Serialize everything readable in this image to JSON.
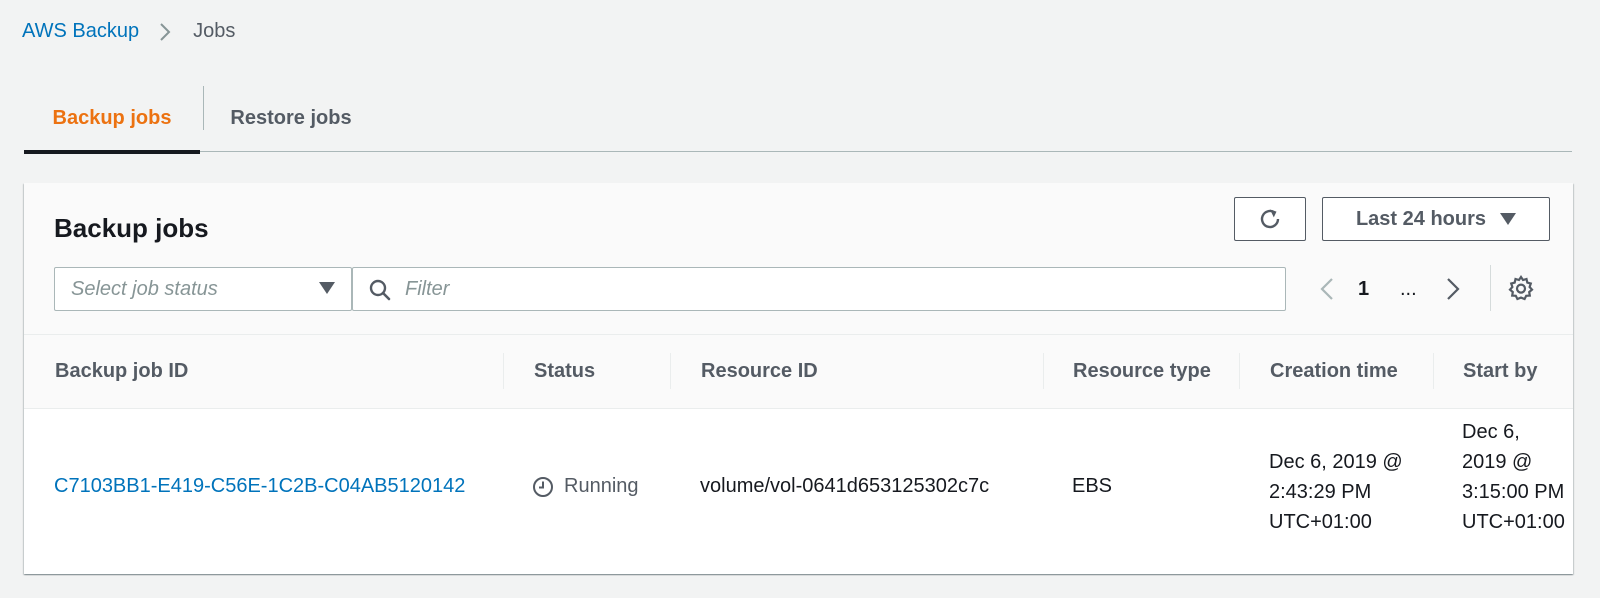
{
  "breadcrumb": {
    "root": "AWS Backup",
    "current": "Jobs"
  },
  "tabs": [
    {
      "label": "Backup jobs",
      "active": true
    },
    {
      "label": "Restore jobs",
      "active": false
    }
  ],
  "panel": {
    "title": "Backup jobs",
    "refresh_icon": "refresh-icon",
    "time_range": "Last 24 hours",
    "status_select_placeholder": "Select job status",
    "filter_placeholder": "Filter",
    "pagination": {
      "current_page": "1",
      "ellipsis": "..."
    }
  },
  "table": {
    "columns": [
      "Backup job ID",
      "Status",
      "Resource ID",
      "Resource type",
      "Creation time",
      "Start by"
    ],
    "rows": [
      {
        "job_id": "C7103BB1-E419-C56E-1C2B-C04AB5120142",
        "status": "Running",
        "resource_id": "volume/vol-0641d653125302c7c",
        "resource_type": "EBS",
        "creation_time": "Dec 6, 2019 @ 2:43:29 PM UTC+01:00",
        "start_by": "Dec 6, 2019 @ 3:15:00 PM UTC+01:00"
      }
    ]
  },
  "colors": {
    "accent": "#ec7211",
    "link": "#0073bb",
    "background": "#f2f3f3",
    "text_secondary": "#545b64"
  }
}
